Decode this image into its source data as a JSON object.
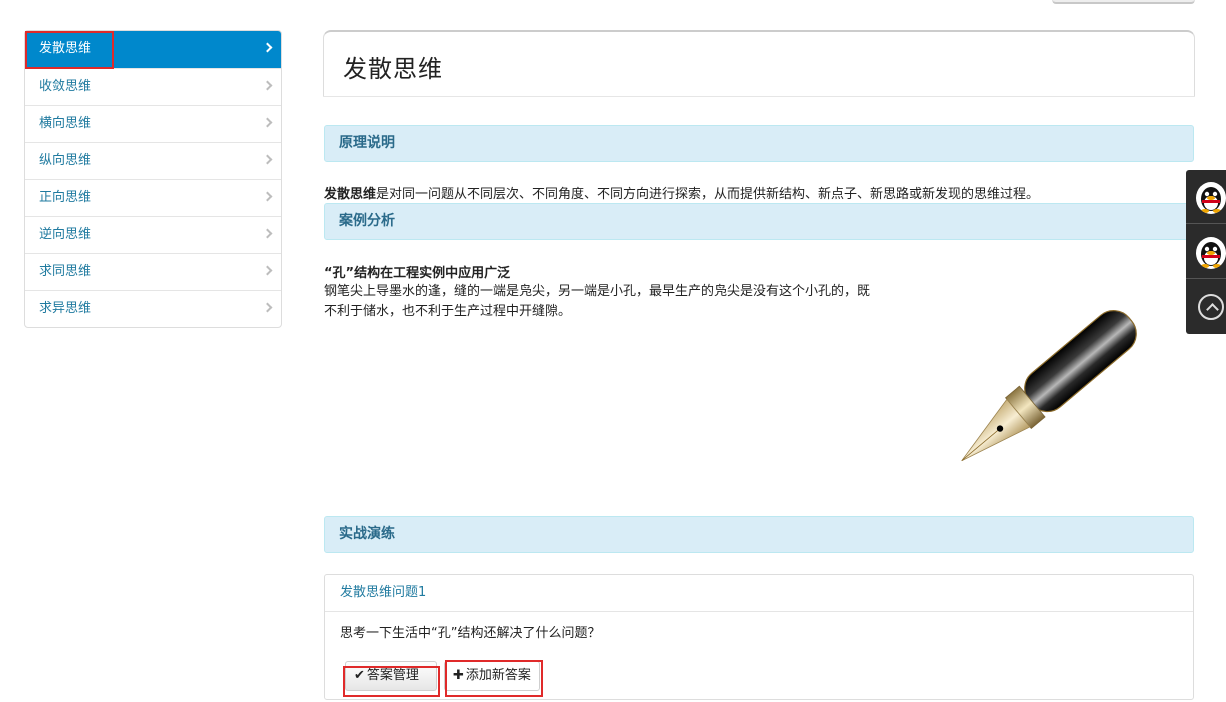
{
  "sidebar": {
    "items": [
      {
        "label": "发散思维",
        "active": true
      },
      {
        "label": "收敛思维"
      },
      {
        "label": "横向思维"
      },
      {
        "label": "纵向思维"
      },
      {
        "label": "正向思维"
      },
      {
        "label": "逆向思维"
      },
      {
        "label": "求同思维"
      },
      {
        "label": "求异思维"
      }
    ]
  },
  "main": {
    "title": "发散思维",
    "sections": {
      "principle": "原理说明",
      "case": "案例分析",
      "practice": "实战演练"
    },
    "principle_term": "发散思维",
    "principle_text": "是对同一问题从不同层次、不同角度、不同方向进行探索，从而提供新结构、新点子、新思路或新发现的思维过程。",
    "case_title": "“孔”结构在工程实例中应用广泛",
    "case_text": "钢笔尖上导墨水的逢，缝的一端是凫尖，另一端是小孔，最早生产的凫尖是没有这个小孔的，既不利于储水，也不利于生产过程中开缝隙。",
    "question": {
      "title": "发散思维问题1",
      "text": "思考一下生活中“孔”结构还解决了什么问题？",
      "manage_label": "答案管理",
      "add_label": "添加新答案"
    }
  },
  "colors": {
    "accent": "#0088cc",
    "link": "#217ba0",
    "section_bg": "#d9edf7",
    "highlight": "#e02a2a"
  },
  "icons": [
    "chevron-right-icon",
    "qq-penguin-icon",
    "back-to-top-icon",
    "check-icon",
    "plus-icon"
  ]
}
